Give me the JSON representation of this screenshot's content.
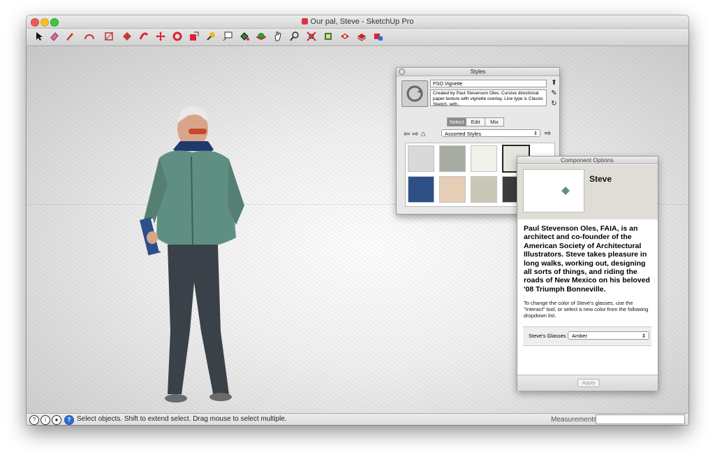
{
  "window": {
    "title": "Our pal, Steve - SketchUp Pro"
  },
  "toolbar": {
    "tools": [
      "select-tool",
      "eraser-tool",
      "line-tool",
      "arc-tool",
      "rectangle-tool",
      "push-pull-tool",
      "offset-tool",
      "move-tool",
      "rotate-tool",
      "scale-tool",
      "tape-measure-tool",
      "text-tool",
      "paint-bucket-tool",
      "orbit-tool",
      "pan-tool",
      "zoom-tool",
      "zoom-extents-tool",
      "3d-warehouse-tool",
      "extension-warehouse-tool",
      "layout-tool",
      "style-builder-tool",
      "send-to-layout-tool"
    ]
  },
  "statusbar": {
    "hint": "Select objects. Shift to extend select. Drag mouse to select multiple.",
    "measurements_label": "Measurements",
    "measurements_value": ""
  },
  "styles_panel": {
    "title": "Styles",
    "style_name": "PSO Vignette",
    "description": "Created by Paul Stevenson Oles.  Cursive directional paper texture with vignette overlay. Line type is Classic Sketch, with...",
    "tabs": [
      "Select",
      "Edit",
      "Mix"
    ],
    "active_tab": "Select",
    "collection": "Assorted Styles",
    "swatch_colors": [
      "#d9d9d9",
      "#a8ada3",
      "#f2f1ea",
      "#e6e5dd",
      "#2e4f86",
      "#e6cdb6",
      "#c9c8b8",
      "#3b3d3c"
    ]
  },
  "component_panel": {
    "title": "Component Options",
    "name": "Steve",
    "bio": "Paul Stevenson Oles, FAIA, is an architect and co-founder of the American Society of Architectural Illustrators. Steve takes pleasure in long walks, working out, designing all sorts of things, and riding the roads of New Mexico on his beloved '08 Triumph Bonneville.",
    "help": "To change the color of Steve's glasses, use the \"Interact\" tool, or select a new color from the following dropdown list.",
    "option_label": "Steve's Glasses",
    "option_value": "Amber",
    "apply_label": "Apply"
  }
}
